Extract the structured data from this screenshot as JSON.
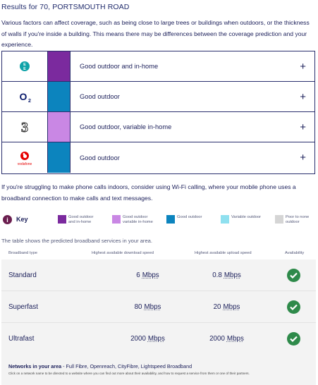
{
  "page": {
    "title": "Results for 70, PORTSMOUTH ROAD",
    "intro": "Various factors can affect coverage, such as being close to large trees or buildings when outdoors, or the thickness of walls if you're inside a building. This means there may be differences between the coverage prediction and your experience."
  },
  "operators": [
    {
      "logo": "EE",
      "logo_icon": "ee-logo-icon",
      "swatch_color": "#7b2a9e",
      "label": "Good outdoor and in-home",
      "logo_color": "#0fa3a8"
    },
    {
      "logo": "O2",
      "logo_icon": "o2-logo-icon",
      "swatch_color": "#0c84be",
      "label": "Good outdoor",
      "logo_color": "#0a1a6b"
    },
    {
      "logo": "3",
      "logo_icon": "three-logo-icon",
      "swatch_color": "#c987e4",
      "label": "Good outdoor, variable in-home",
      "logo_color": "#222222"
    },
    {
      "logo": "vodafone",
      "logo_icon": "vodafone-logo-icon",
      "swatch_color": "#0c84be",
      "label": "Good outdoor",
      "logo_color": "#e60000"
    }
  ],
  "plus_symbol": "+",
  "wifi_note": "If you're struggling to make phone calls indoors, consider using Wi-Fi calling, where your mobile phone uses a broadband connection to make calls and text messages.",
  "key": {
    "icon": "i",
    "title": "Key",
    "items": [
      {
        "color": "#7b2a9e",
        "label": "Good outdoor and in-home"
      },
      {
        "color": "#c987e4",
        "label": "Good outdoor variable in-home"
      },
      {
        "color": "#0c84be",
        "label": "Good outdoor"
      },
      {
        "color": "#8fe0ef",
        "label": "Variable outdoor"
      },
      {
        "color": "#d5d5d5",
        "label": "Poor to none outdoor"
      }
    ]
  },
  "broadband": {
    "intro": "The table shows the predicted broadband services in your area.",
    "headers": [
      "Broadband type",
      "Highest available download speed",
      "Highest available upload speed",
      "Availability"
    ],
    "rows": [
      {
        "type": "Standard",
        "down_value": "6",
        "down_unit": "Mbps",
        "up_value": "0.8",
        "up_unit": "Mbps",
        "available": true
      },
      {
        "type": "Superfast",
        "down_value": "80",
        "down_unit": "Mbps",
        "up_value": "20",
        "up_unit": "Mbps",
        "available": true
      },
      {
        "type": "Ultrafast",
        "down_value": "2000",
        "down_unit": "Mbps",
        "up_value": "2000",
        "up_unit": "Mbps",
        "available": true
      }
    ],
    "check_color": "#2e8a4a"
  },
  "networks": {
    "title_bold": "Networks in your area",
    "title_rest": " - Full Fibre, Openreach, CityFibre, Lightspeed Broadband",
    "subtitle": "Click on a network name to be directed to a website where you can find out more about their availability, and how to request a service from them or one of their partners."
  }
}
